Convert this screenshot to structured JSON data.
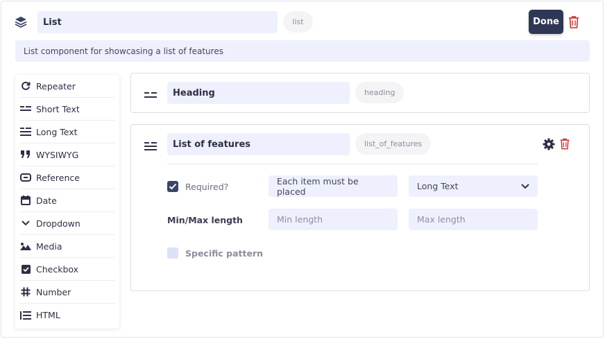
{
  "header": {
    "name_value": "List",
    "slug": "list",
    "done_label": "Done",
    "description": "List component for showcasing a list of features"
  },
  "palette": {
    "items": [
      {
        "label": "Repeater",
        "icon": "repeat-icon"
      },
      {
        "label": "Short Text",
        "icon": "short-text-icon"
      },
      {
        "label": "Long Text",
        "icon": "long-text-icon"
      },
      {
        "label": "WYSIWYG",
        "icon": "quote-icon"
      },
      {
        "label": "Reference",
        "icon": "link-icon"
      },
      {
        "label": "Date",
        "icon": "calendar-icon"
      },
      {
        "label": "Dropdown",
        "icon": "chevron-down-icon"
      },
      {
        "label": "Media",
        "icon": "image-icon"
      },
      {
        "label": "Checkbox",
        "icon": "checkbox-icon"
      },
      {
        "label": "Number",
        "icon": "hash-icon"
      },
      {
        "label": "HTML",
        "icon": "list-icon"
      }
    ]
  },
  "fields": [
    {
      "name": "Heading",
      "key": "heading"
    },
    {
      "name": "List of features",
      "key": "list_of_features",
      "required_label": "Required?",
      "required_checked": true,
      "required_message": "Each item must be placed",
      "type_select": "Long Text",
      "minmax_label": "Min/Max length",
      "min_placeholder": "Min length",
      "max_placeholder": "Max length",
      "pattern_label": "Specific pattern",
      "pattern_checked": false
    }
  ],
  "colors": {
    "accent": "#2f3757",
    "danger": "#c9302c",
    "input_bg": "#eef0fd"
  }
}
